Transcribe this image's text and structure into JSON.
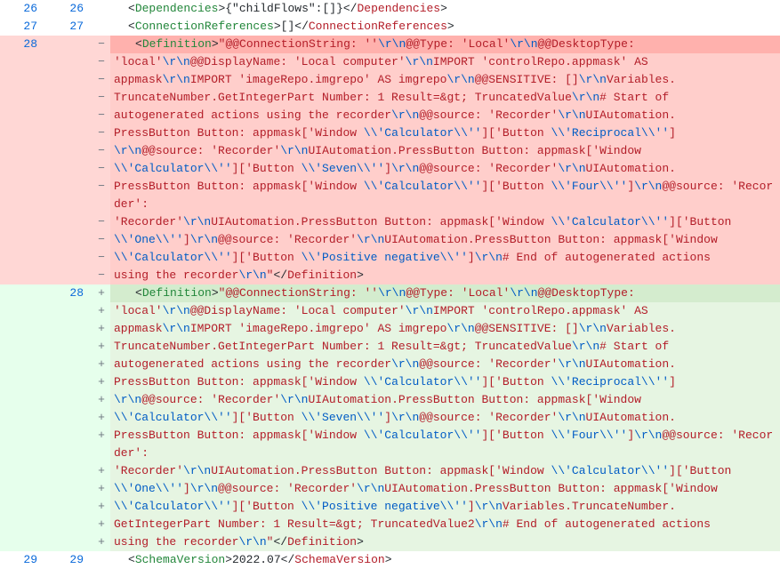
{
  "lines": {
    "n26_old": "26",
    "n26_new": "26",
    "n27_old": "27",
    "n27_new": "27",
    "n28_old": "28",
    "n28_new": "28",
    "n29_old": "29",
    "n29_new": "29"
  },
  "markers": {
    "minus": "−",
    "plus": "+"
  },
  "tags": {
    "Dependencies_o": "<Dependencies",
    "Dependencies_c": "</Dependencies",
    "ConnectionReferences_o": "<ConnectionReferences",
    "ConnectionReferences_c": "</ConnectionReferences",
    "Definition_o": "<Definition",
    "Definition_c": "</Definition",
    "SchemaVersion_o": "<SchemaVersion",
    "SchemaVersion_c": "</SchemaVersion",
    "gt": ">"
  },
  "txt": {
    "deps_body": "{\"childFlows\":[]}",
    "conn_body": "[]",
    "schema_body": "2022.07",
    "amp_gt": "&gt;",
    "rn": "\\r\\n",
    "seg_def_head1": "\"@@ConnectionString: ''",
    "seg_def_head2": "@@Type: 'Local'",
    "seg_def_head3": "@@DesktopType: ",
    "seg_local": "'local'",
    "seg_disp": "@@DisplayName: 'Local computer'",
    "seg_import1": "IMPORT 'controlRepo.appmask' AS ",
    "seg_appmask": "appmask",
    "seg_import2": "IMPORT 'imageRepo.imgrepo' AS imgrepo",
    "seg_sens": "@@SENSITIVE: []",
    "seg_vars": "Variables.",
    "seg_trunc1": "TruncateNumber.GetIntegerPart Number: 1 Result=",
    "seg_truncval": " TruncatedValue",
    "seg_truncval2": " TruncatedValue2",
    "seg_startauto": "# Start of ",
    "seg_autogen": "autogenerated actions using the recorder",
    "seg_src": "@@source: 'Recorder'",
    "seg_uia": "UIAutomation.",
    "seg_press": "PressButton Button: appmask['Window ",
    "seg_calc": "\\\\'Calculator\\\\''",
    "seg_b": "]['Button ",
    "seg_rec": "\\\\'Reciprocal\\\\''",
    "seg_sev": "\\\\'Seven\\\\''",
    "seg_four": "\\\\'Four\\\\''",
    "seg_one": "\\\\'One\\\\''",
    "seg_pos": "\\\\'Positive negative\\\\''",
    "seg_close": "]",
    "seg_endauto": "# End of autogenerated actions ",
    "seg_using": "using the recorder",
    "seg_quote": "\"",
    "seg_varstrunc": "Variables.TruncateNumber.",
    "seg_getint": "GetIntegerPart Number: 1 Result="
  }
}
